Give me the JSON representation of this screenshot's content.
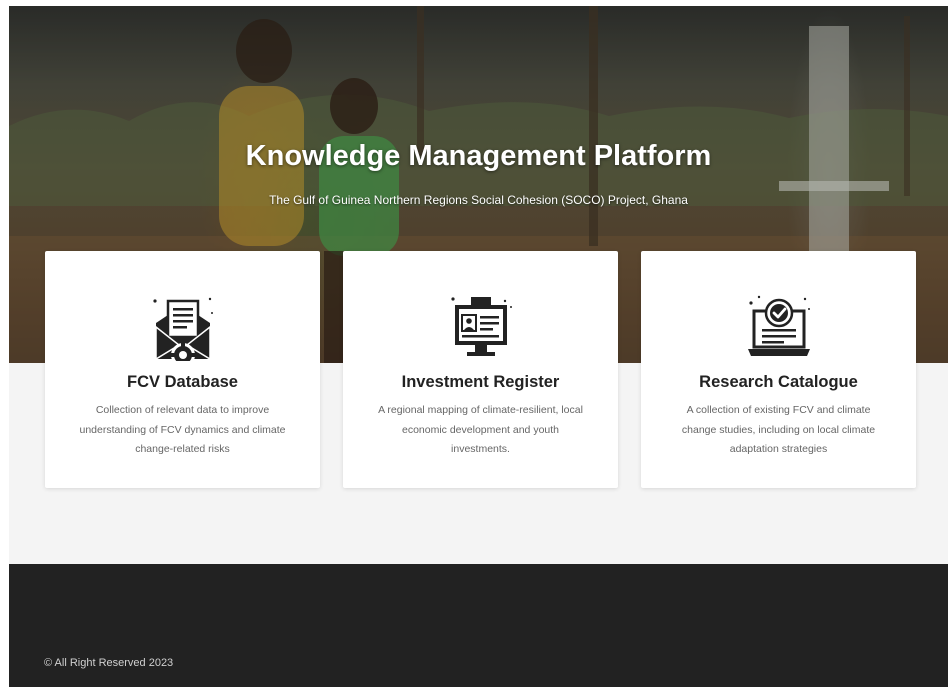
{
  "hero": {
    "title": "Knowledge Management Platform",
    "subtitle": "The Gulf of Guinea Northern Regions Social Cohesion (SOCO) Project, Ghana",
    "background_image": "children-at-water-pump-photo"
  },
  "cards": [
    {
      "icon": "database-envelope-gear-icon",
      "title": "FCV Database",
      "description": "Collection of relevant data to improve understanding of FCV dynamics and climate change-related risks"
    },
    {
      "icon": "monitor-id-card-icon",
      "title": "Investment Register",
      "description": "A regional mapping of climate-resilient, local economic development and youth investments."
    },
    {
      "icon": "laptop-checkmark-icon",
      "title": "Research Catalogue",
      "description": "A collection of existing FCV and climate change studies, including on local climate adaptation strategies"
    }
  ],
  "footer": {
    "copyright": "© All Right Reserved 2023"
  },
  "colors": {
    "card_background": "#ffffff",
    "title_text": "#222222",
    "description_text": "#666666",
    "footer_background": "#222222",
    "page_background": "#f4f4f4"
  }
}
